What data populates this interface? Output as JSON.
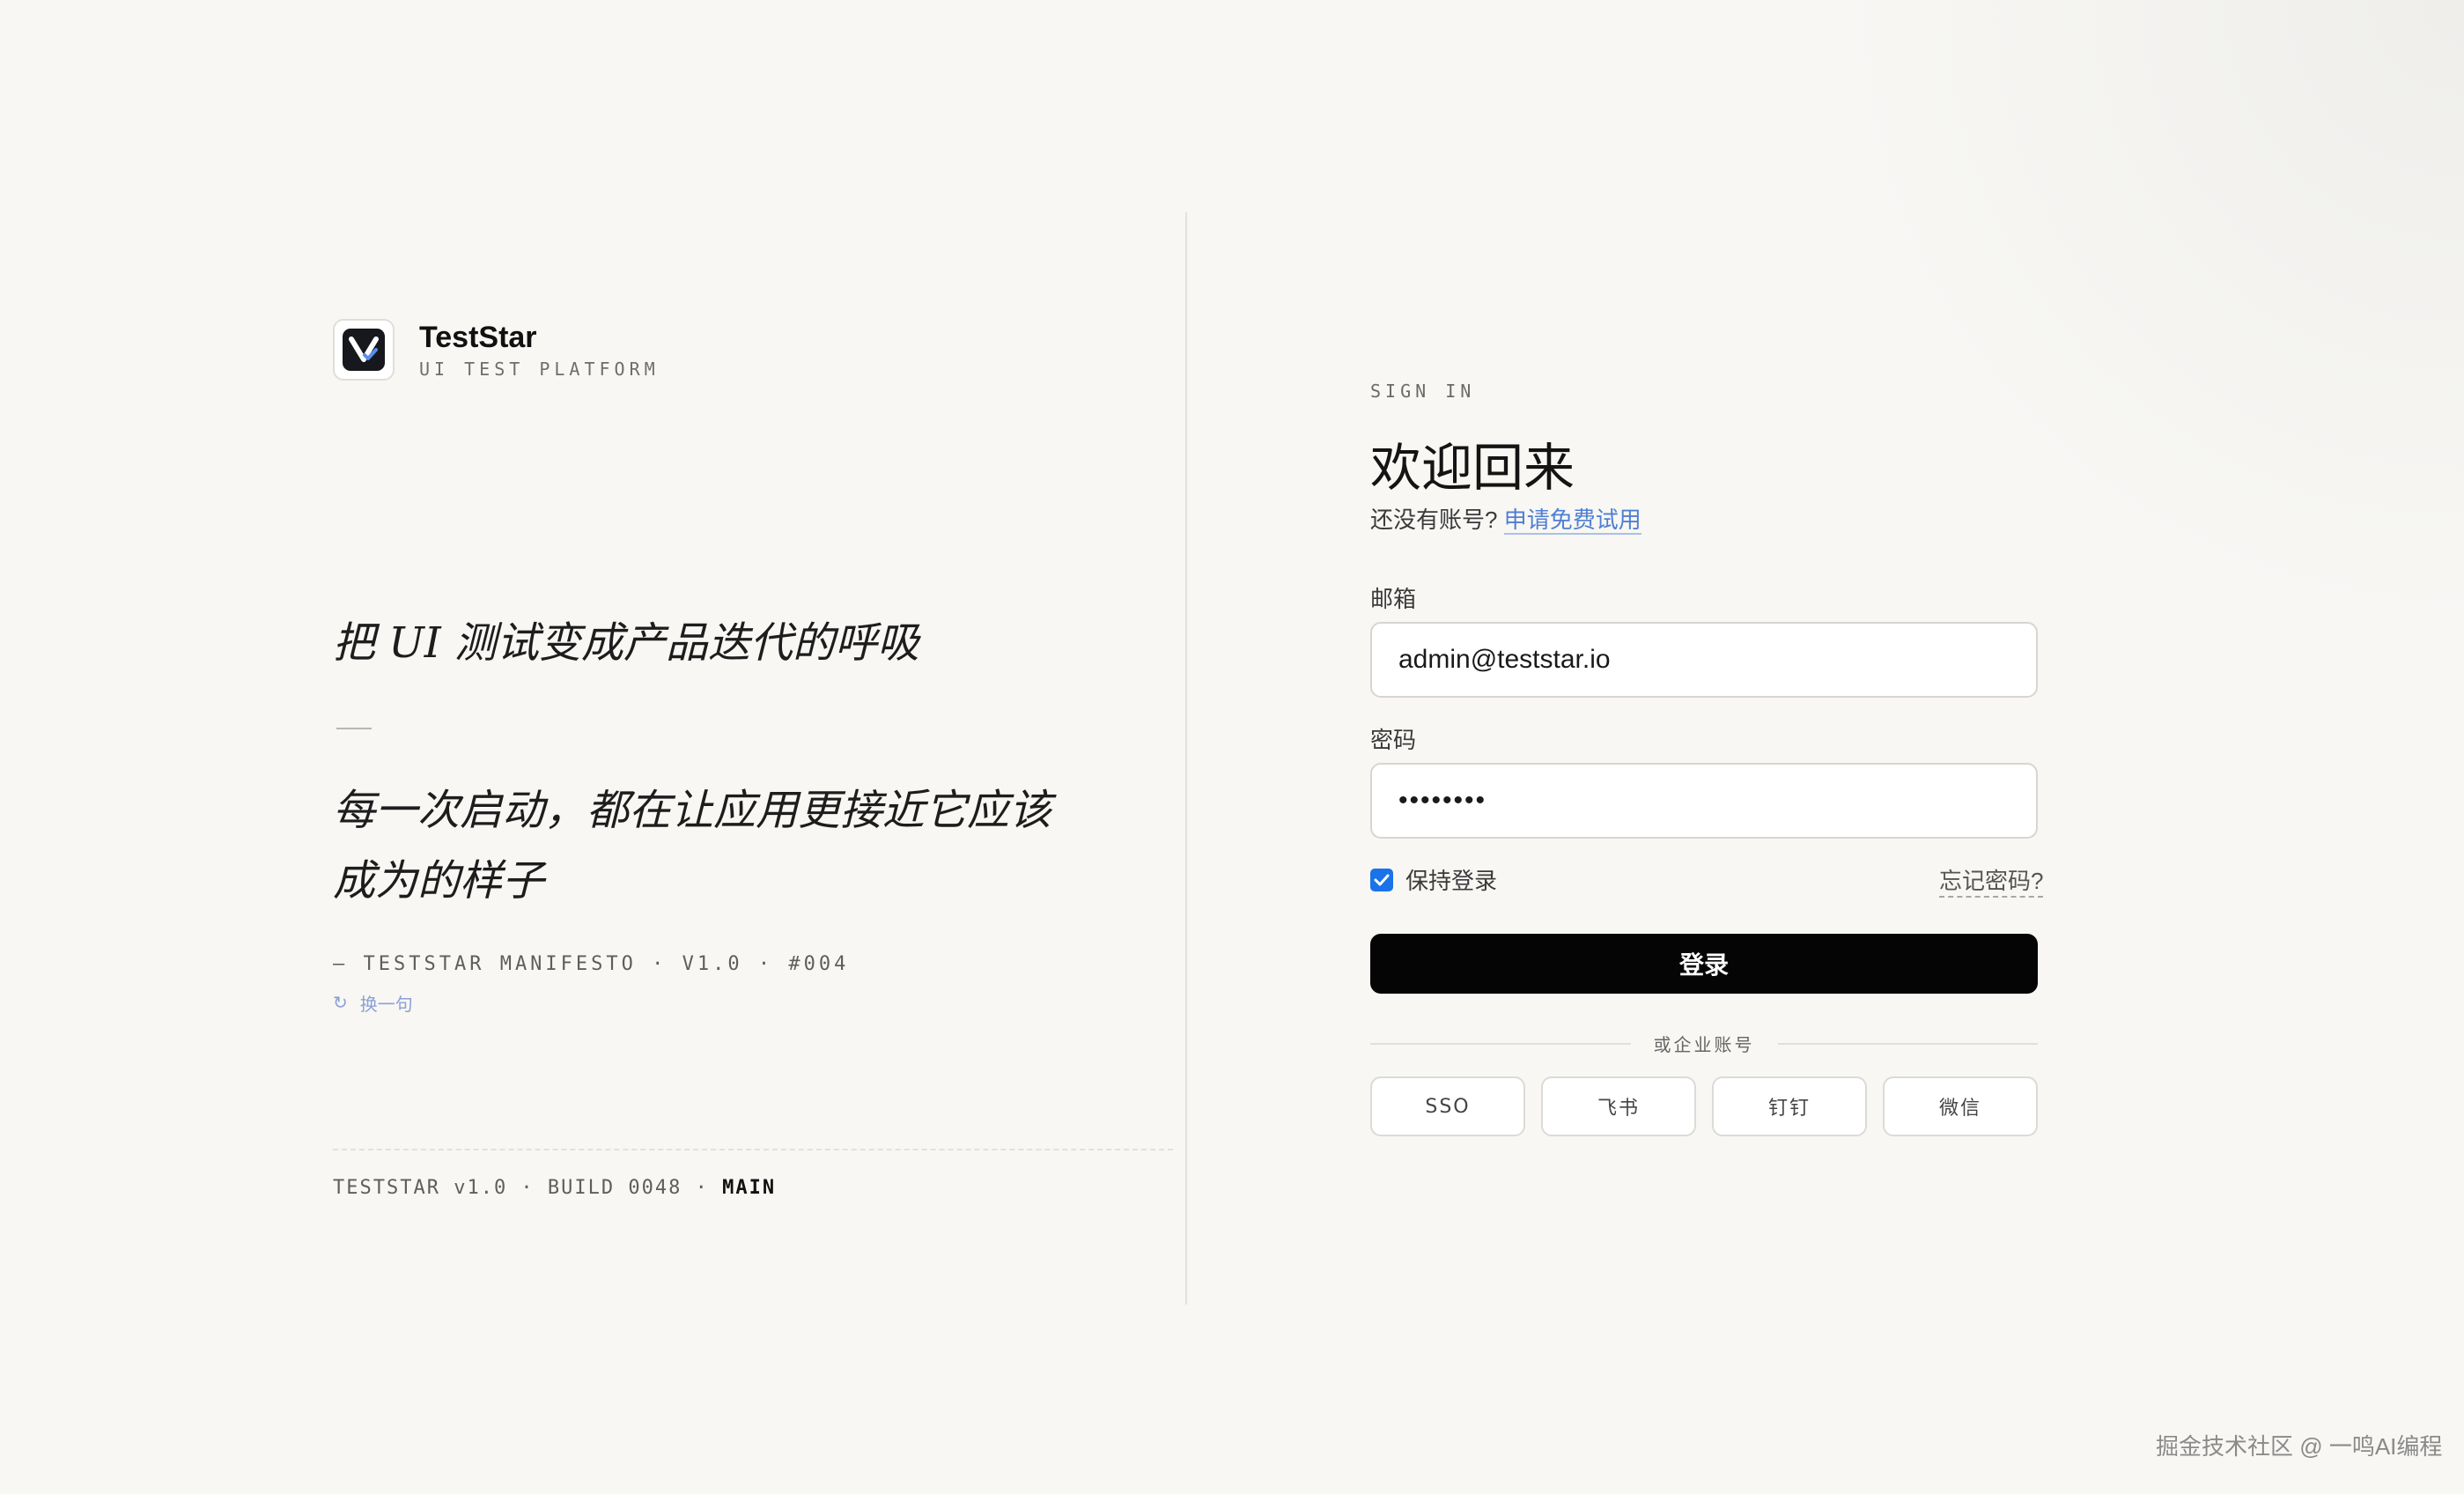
{
  "brand": {
    "name": "TestStar",
    "subtitle": "UI TEST PLATFORM"
  },
  "manifesto": {
    "quote_main": "把 UI 测试变成产品迭代的呼吸",
    "quote_sub": "每一次启动，都在让应用更接近它应该成为的样子",
    "attribution": "— TESTSTAR MANIFESTO · V1.0 · #004",
    "swap_icon": "refresh-icon",
    "swap_label": "换一句"
  },
  "footer": {
    "build_prefix": "TESTSTAR v1.0 · BUILD 0048 ·",
    "branch": "MAIN"
  },
  "signin": {
    "kicker": "SIGN IN",
    "title": "欢迎回来",
    "no_account_text": "还没有账号?",
    "trial_link": "申请免费试用",
    "email_label": "邮箱",
    "email_value": "admin@teststar.io",
    "password_label": "密码",
    "password_value": "••••••••",
    "remember_label": "保持登录",
    "remember_checked": true,
    "forgot_link": "忘记密码?",
    "login_button": "登录",
    "or_text": "或企业账号",
    "sso_options": [
      "SSO",
      "飞书",
      "钉钉",
      "微信"
    ]
  },
  "watermark": "掘金技术社区 @ 一鸣AI编程",
  "colors": {
    "background": "#f8f7f4",
    "primary_button": "#050505",
    "link": "#4f7fd3",
    "checkbox": "#1a73e8"
  }
}
